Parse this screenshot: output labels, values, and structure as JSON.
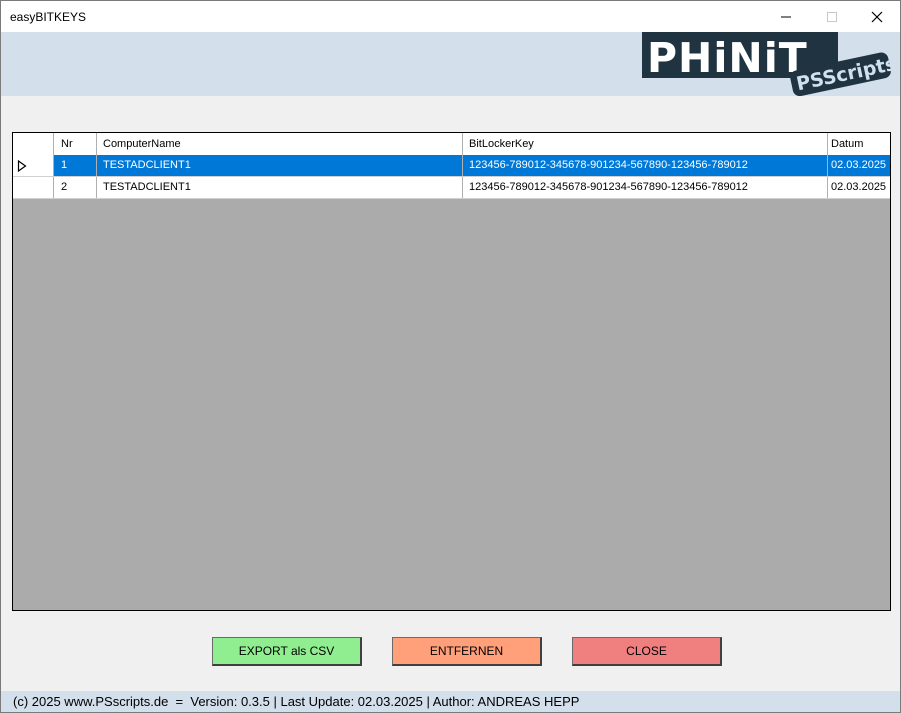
{
  "window": {
    "title": "easyBITKEYS",
    "controls": {
      "minimize": "—",
      "maximize": "☐",
      "close": "✕"
    }
  },
  "logo": {
    "text_main": "PHiNiT",
    "text_sub": "PSScripts"
  },
  "grid": {
    "columns": [
      "Nr",
      "ComputerName",
      "BitLockerKey",
      "Datum"
    ],
    "rows": [
      {
        "nr": "1",
        "computer": "TESTADCLIENT1",
        "key": "123456-789012-345678-901234-567890-123456-789012",
        "date": "02.03.2025",
        "selected": true
      },
      {
        "nr": "2",
        "computer": "TESTADCLIENT1",
        "key": "123456-789012-345678-901234-567890-123456-789012",
        "date": "02.03.2025",
        "selected": false
      }
    ]
  },
  "buttons": {
    "export": "EXPORT als CSV",
    "remove": "ENTFERNEN",
    "close": "CLOSE"
  },
  "colors": {
    "export_bg": "#90ee90",
    "remove_bg": "#ffa07a",
    "close_bg": "#f08080",
    "selection": "#0078d7",
    "header_band": "#d4dfec",
    "grid_empty": "#ababab"
  },
  "status": {
    "text": "(c) 2025 www.PSscripts.de  =  Version: 0.3.5 | Last Update: 02.03.2025 | Author: ANDREAS HEPP"
  }
}
